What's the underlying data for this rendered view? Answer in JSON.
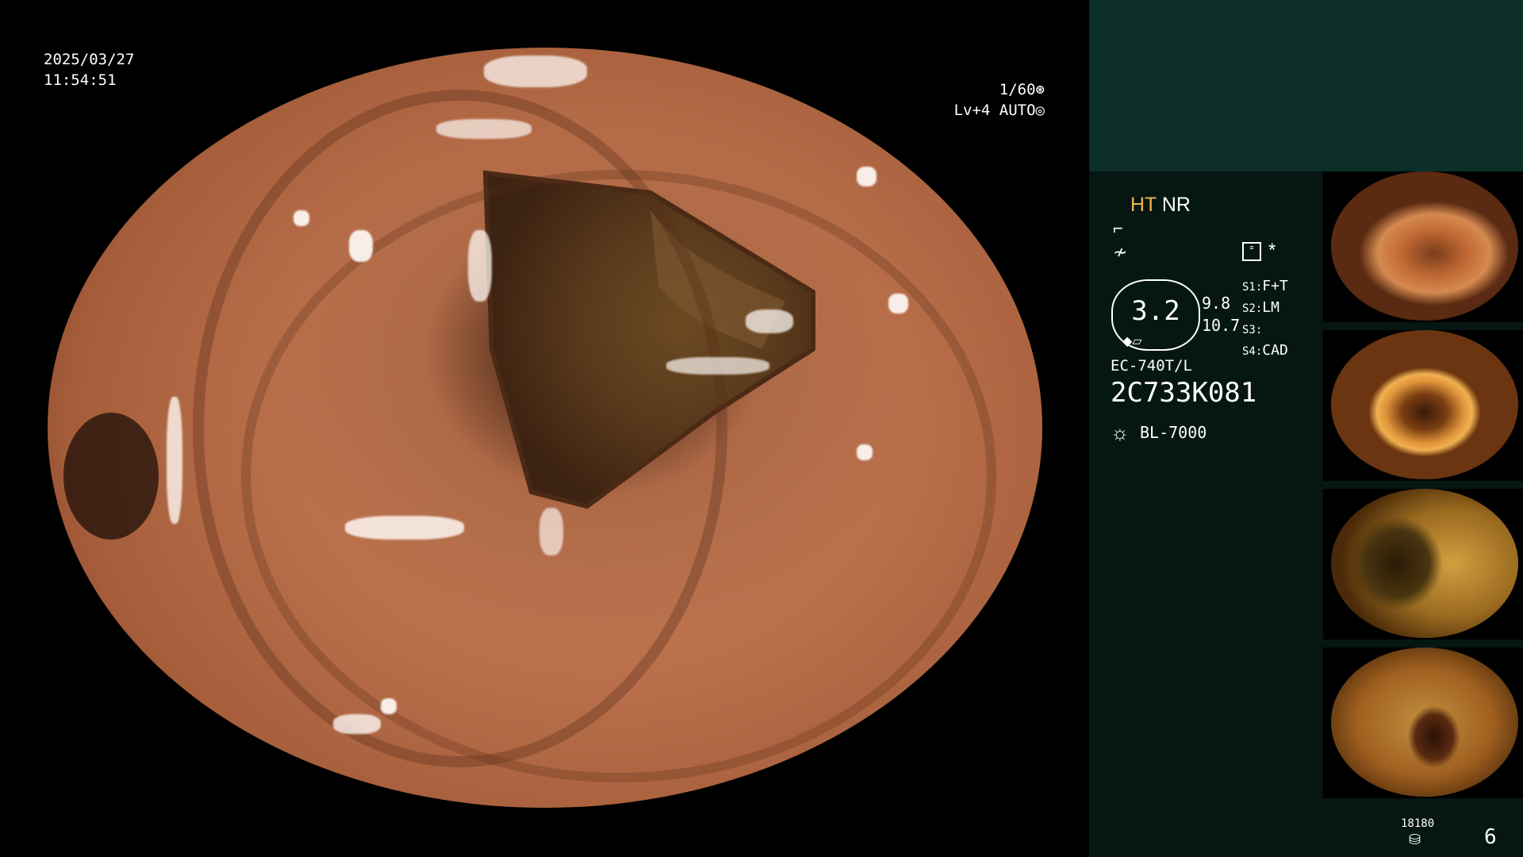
{
  "osd": {
    "date": "2025/03/27",
    "time": "11:54:51",
    "shutter": "1/60",
    "level": "Lv+4",
    "iris_mode": "AUTO"
  },
  "panel": {
    "mode_ht": "HT",
    "mode_nr": "NR",
    "zoom_value": "3.2",
    "value_top": "9.8",
    "value_bottom": "10.7",
    "switches": [
      {
        "key": "S1:",
        "value": "F+T"
      },
      {
        "key": "S2:",
        "value": "LM"
      },
      {
        "key": "S3:",
        "value": ""
      },
      {
        "key": "S4:",
        "value": "CAD"
      }
    ],
    "scope_model": "EC-740T/L",
    "scope_serial": "2C733K081",
    "light_source": "BL-7000",
    "storage_count": "18180",
    "image_count": "6"
  },
  "colors": {
    "panel_bg": "#061613",
    "panel_top_bg": "#0c2e29",
    "ht_accent": "#f0b84a",
    "mucosa": "#c9805a"
  },
  "icons": {
    "shutter": "aperture-icon",
    "iris": "iris-icon",
    "structure": "structure-enhance-icon",
    "color": "color-enhance-icon",
    "memo": "memo-icon",
    "star": "star-icon",
    "light": "light-source-icon",
    "storage": "storage-icon"
  }
}
